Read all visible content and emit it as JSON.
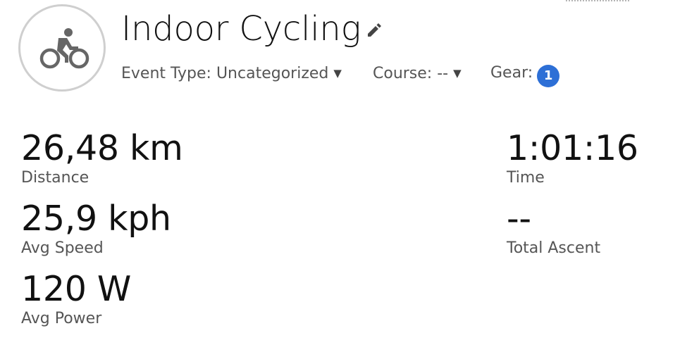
{
  "activity": {
    "title": "Indoor Cycling",
    "icon": "cyclist-icon",
    "edit_icon": "pencil-icon"
  },
  "meta": {
    "event_type": "Event Type: Uncategorized",
    "course": "Course: --",
    "gear_label": "Gear:",
    "gear_count": "1"
  },
  "stats": {
    "distance": {
      "value": "26,48 km",
      "label": "Distance"
    },
    "avg_speed": {
      "value": "25,9 kph",
      "label": "Avg Speed"
    },
    "avg_power": {
      "value": "120 W",
      "label": "Avg Power"
    },
    "time": {
      "value": "1:01:16",
      "label": "Time"
    },
    "total_ascent": {
      "value": "--",
      "label": "Total Ascent"
    }
  },
  "colors": {
    "badge": "#2d6fd6",
    "avatar_border": "#cfcfcf"
  }
}
